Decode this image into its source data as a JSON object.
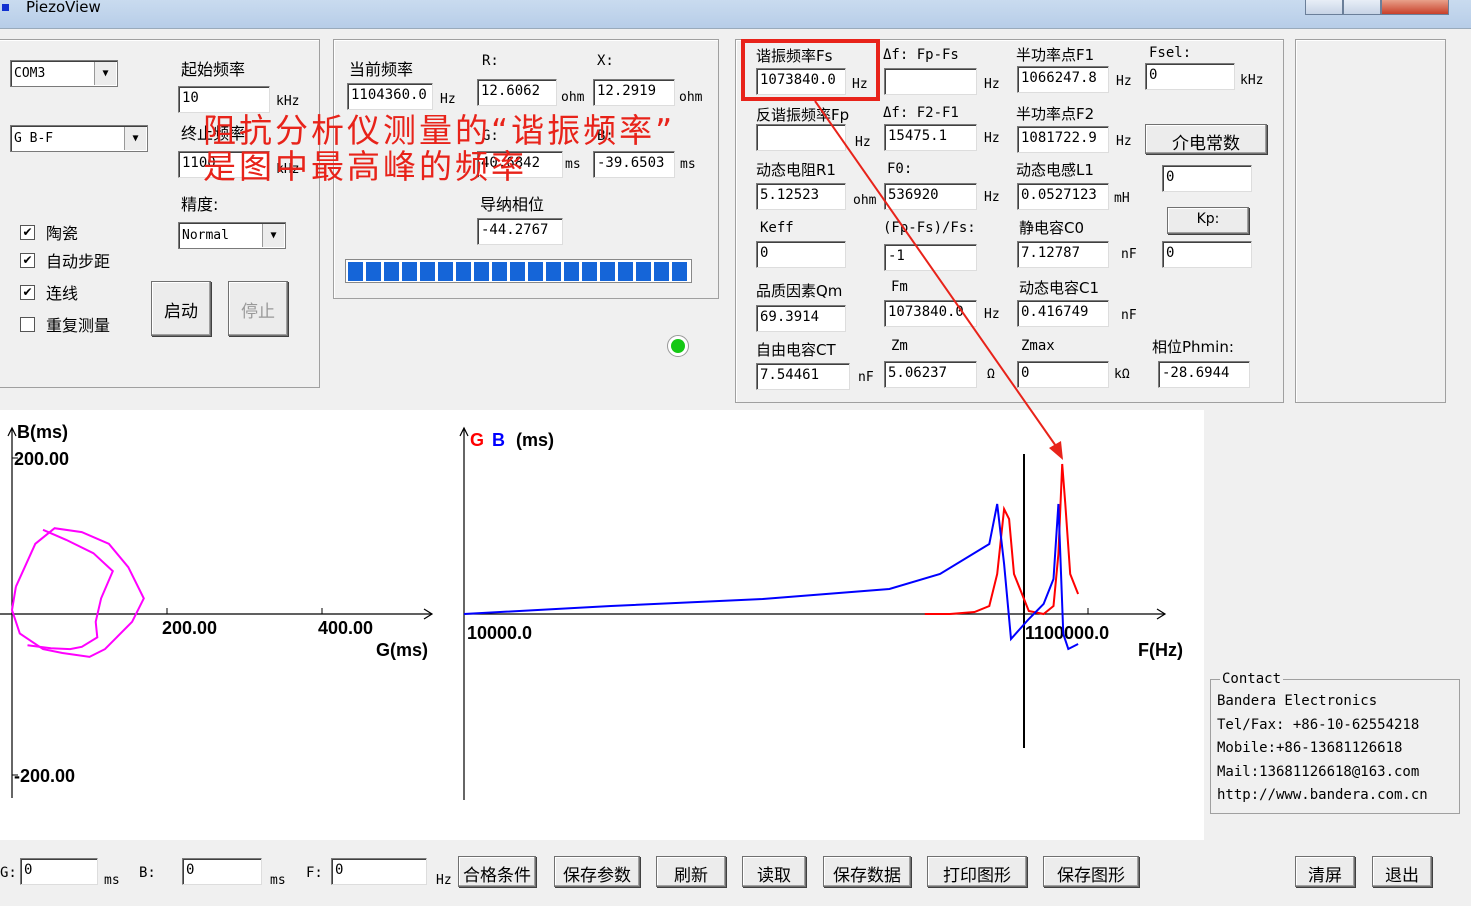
{
  "window": {
    "title": "PiezoView"
  },
  "left_panel": {
    "port": "COM3",
    "mode": "G B-F",
    "start_freq_label": "起始频率",
    "start_freq_value": "10",
    "end_freq_label": "终止频率",
    "end_freq_value": "1100",
    "khz": "kHz",
    "precision_label": "精度:",
    "precision_value": "Normal",
    "checkboxes": [
      {
        "label": "陶瓷",
        "checked": true
      },
      {
        "label": "自动步距",
        "checked": true
      },
      {
        "label": "连线",
        "checked": true
      },
      {
        "label": "重复测量",
        "checked": false
      }
    ],
    "start_button": "启动",
    "stop_button": "停止"
  },
  "measure_panel": {
    "cur_freq_label": "当前频率",
    "cur_freq_value": "1104360.0",
    "hz": "Hz",
    "r_label": "R:",
    "r_value": "12.6062",
    "ohm": "ohm",
    "x_label": "X:",
    "x_value": "12.2919",
    "g_label": "G:",
    "g_value": "40.6842",
    "b_label": "B:",
    "b_value": "-39.6503",
    "ms": "ms",
    "phase_label": "导纳相位",
    "phase_value": "-44.2767",
    "progress_segments": 19
  },
  "results_panel": {
    "fs_label": "谐振频率Fs",
    "fs_value": "1073840.0",
    "df_fp_fs_label": "Δf: Fp-Fs",
    "df_fp_fs_value": "",
    "f1_label": "半功率点F1",
    "f1_value": "1066247.8",
    "fsel_label": "Fsel:",
    "fsel_value": "0",
    "fp_label": "反谐振频率Fp",
    "fp_value": "",
    "df_f2_f1_label": "Δf: F2-F1",
    "df_f2_f1_value": "15475.1",
    "f2_label": "半功率点F2",
    "f2_value": "1081722.9",
    "dielectric_button": "介电常数",
    "r1_label": "动态电阻R1",
    "r1_value": "5.12523",
    "f0_label": "F0:",
    "f0_value": "536920",
    "l1_label": "动态电感L1",
    "l1_value": "0.0527123",
    "dielectric_value": "0",
    "keff_label": "Keff",
    "keff_value": "0",
    "fpfs_label": "(Fp-Fs)/Fs:",
    "fpfs_value": "-1",
    "c0_label": "静电容C0",
    "c0_value": "7.12787",
    "kp_button": "Kp:",
    "kp_value": "0",
    "qm_label": "品质因素Qm",
    "qm_value": "69.3914",
    "fm_label": "Fm",
    "fm_value": "1073840.0",
    "c1_label": "动态电容C1",
    "c1_value": "0.416749",
    "ct_label": "自由电容CT",
    "ct_value": "7.54461",
    "zm_label": "Zm",
    "zm_value": "5.06237",
    "zmax_label": "Zmax",
    "zmax_value": "0",
    "phmin_label": "相位Phmin:",
    "phmin_value": "-28.6944",
    "units": {
      "hz": "Hz",
      "ohm": "ohm",
      "mh": "mH",
      "nf": "nF",
      "omega": "Ω",
      "kohm": "kΩ"
    }
  },
  "annotation": {
    "line1": "阻抗分析仪测量的“谐振频率”",
    "line2": "是图中最高峰的频率",
    "color": "#e8231a"
  },
  "chart_data": [
    {
      "type": "line",
      "title": "",
      "ylabel": "B(ms)",
      "xlabel": "G(ms)",
      "tick_labels": {
        "y_top": "200.00",
        "y_bottom": "-200.00",
        "x1": "200.00",
        "x2": "400.00"
      },
      "color": "#ff00ff",
      "series": [
        {
          "x": [
            5,
            30,
            55,
            90,
            125,
            150,
            170,
            155,
            135,
            120,
            100,
            65,
            40,
            10,
            0,
            5
          ],
          "y": [
            35,
            90,
            110,
            105,
            90,
            60,
            20,
            -10,
            -30,
            -45,
            -55,
            -50,
            -45,
            -25,
            5,
            35
          ]
        },
        {
          "x": [
            40,
            70,
            105,
            130,
            115,
            108,
            110,
            90,
            75,
            50,
            20
          ],
          "y": [
            108,
            95,
            78,
            55,
            20,
            -10,
            -30,
            -42,
            -45,
            -44,
            -40
          ]
        }
      ]
    },
    {
      "type": "line",
      "title": "",
      "legend": [
        {
          "name": "G",
          "color": "#ff0000"
        },
        {
          "name": "B",
          "color": "#0000ff"
        }
      ],
      "unit_label": "(ms)",
      "xlabel": "F(Hz)",
      "x_tick_labels": [
        "10000.0",
        "1100000.0"
      ],
      "series": [
        {
          "name": "G",
          "color": "#ff0000",
          "x": [
            920000,
            960000,
            985000,
            1000000,
            1008000,
            1015000,
            1020000,
            1025000,
            1040000,
            1055000,
            1065000,
            1070000,
            1073840,
            1077000,
            1082000,
            1090000
          ],
          "y": [
            0,
            0,
            2,
            8,
            40,
            105,
            95,
            40,
            3,
            0,
            8,
            60,
            150,
            110,
            40,
            20
          ]
        },
        {
          "name": "B",
          "color": "#0000ff",
          "x": [
            10000,
            300000,
            600000,
            850000,
            950000,
            1000000,
            1008000,
            1015000,
            1022000,
            1040000,
            1055000,
            1065000,
            1070000,
            1075000,
            1080000,
            1090000
          ],
          "y": [
            0,
            8,
            15,
            25,
            40,
            70,
            110,
            50,
            -25,
            -5,
            10,
            35,
            110,
            -20,
            -35,
            -30
          ]
        }
      ]
    }
  ],
  "contact": {
    "title": "Contact",
    "lines": [
      "Bandera Electronics",
      "Tel/Fax: +86-10-62554218",
      "Mobile:+86-13681126618",
      "Mail:13681126618@163.com",
      "http://www.bandera.com.cn"
    ]
  },
  "bottom_bar": {
    "g_label": "G:",
    "g_value": "0",
    "ms": "ms",
    "b_label": "B:",
    "b_value": "0",
    "f_label": "F:",
    "f_value": "0",
    "hz": "Hz",
    "buttons": [
      "合格条件",
      "保存参数",
      "刷新",
      "读取",
      "保存数据",
      "打印图形",
      "保存图形"
    ],
    "clear_button": "清屏",
    "exit_button": "退出"
  }
}
